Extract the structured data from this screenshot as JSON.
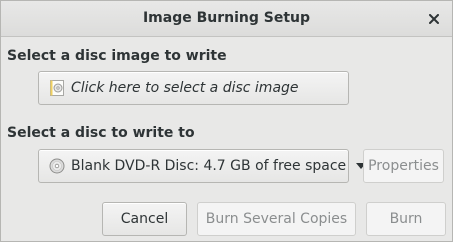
{
  "window": {
    "title": "Image Burning Setup",
    "close_icon": "close-icon"
  },
  "image_section": {
    "label": "Select a disc image to write",
    "chooser_label": "Click here to select a disc image",
    "chooser_icon": "disc-image-file-icon"
  },
  "disc_section": {
    "label": "Select a disc to write to",
    "selected_disc": "Blank DVD-R Disc: 4.7 GB of free space",
    "disc_icon": "optical-disc-icon",
    "properties_label": "Properties"
  },
  "actions": {
    "cancel_label": "Cancel",
    "burn_several_label": "Burn Several Copies",
    "burn_label": "Burn"
  },
  "colors": {
    "text": "#2e3436",
    "disabled_text": "#8b8e8f",
    "background": "#e8e8e7"
  }
}
